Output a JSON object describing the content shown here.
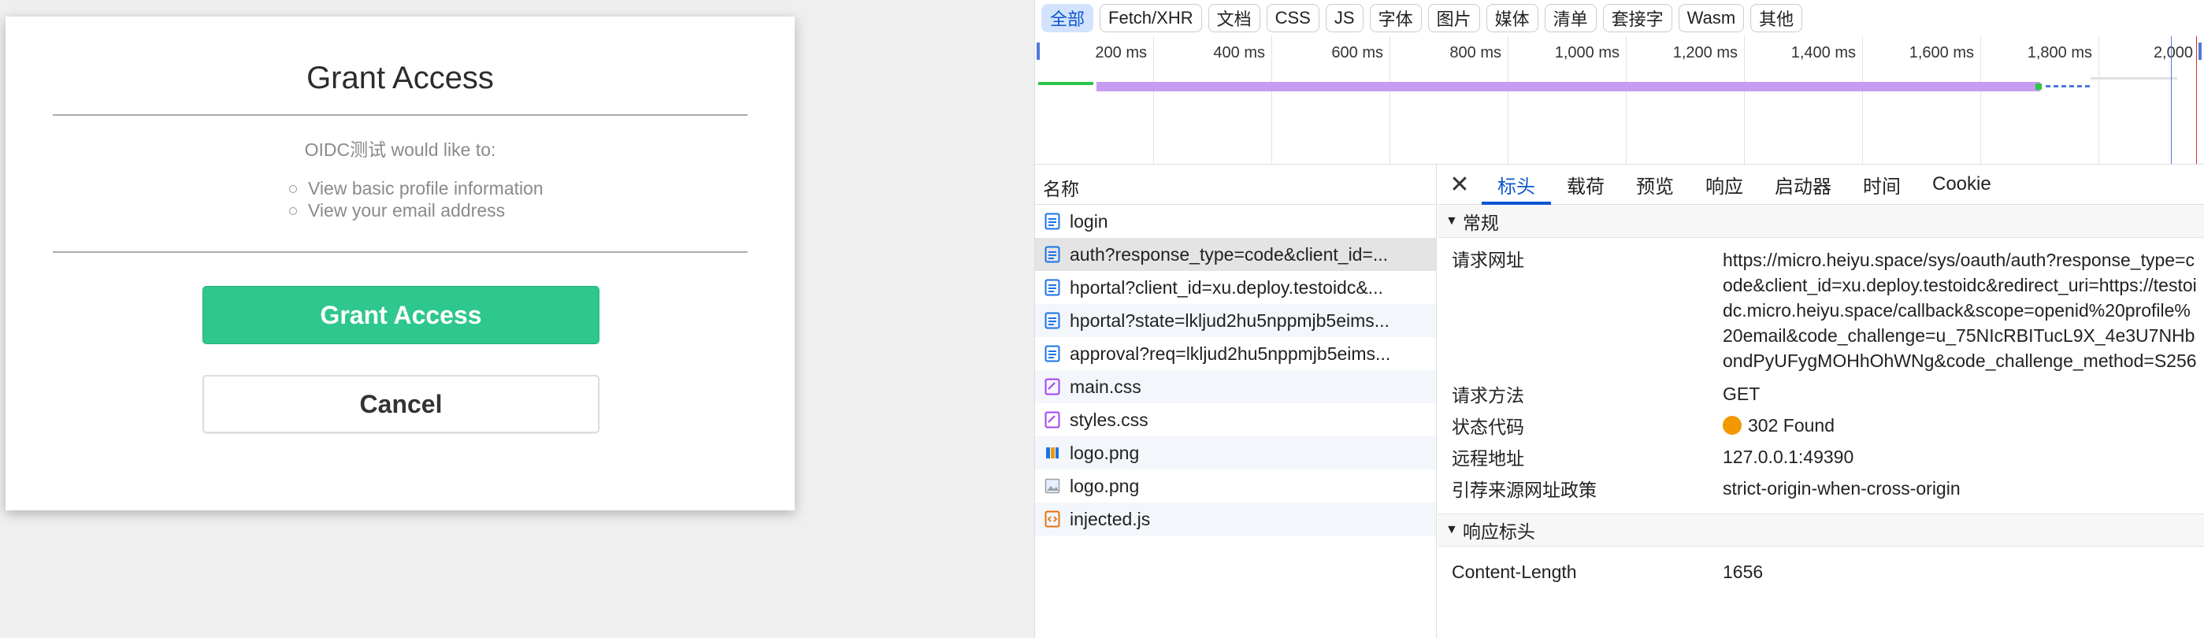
{
  "consent": {
    "title": "Grant Access",
    "prompt": "OIDC测试 would like to:",
    "permissions": [
      "View basic profile information",
      "View your email address"
    ],
    "grant_label": "Grant Access",
    "cancel_label": "Cancel",
    "accent": "#2ec78e"
  },
  "devtools": {
    "filters": [
      "全部",
      "Fetch/XHR",
      "文档",
      "CSS",
      "JS",
      "字体",
      "图片",
      "媒体",
      "清单",
      "套接字",
      "Wasm",
      "其他"
    ],
    "timeline_ticks": [
      "200 ms",
      "400 ms",
      "600 ms",
      "800 ms",
      "1,000 ms",
      "1,200 ms",
      "1,400 ms",
      "1,600 ms",
      "1,800 ms",
      "2,000"
    ],
    "name_header": "名称",
    "requests": [
      {
        "name": "login",
        "icon": "document-icon"
      },
      {
        "name": "auth?response_type=code&client_id=...",
        "icon": "document-icon"
      },
      {
        "name": "hportal?client_id=xu.deploy.testoidc&...",
        "icon": "document-icon"
      },
      {
        "name": "hportal?state=lkljud2hu5nppmjb5eims...",
        "icon": "document-icon"
      },
      {
        "name": "approval?req=lkljud2hu5nppmjb5eims...",
        "icon": "document-icon"
      },
      {
        "name": "main.css",
        "icon": "stylesheet-icon"
      },
      {
        "name": "styles.css",
        "icon": "stylesheet-icon"
      },
      {
        "name": "logo.png",
        "icon": "image-icon"
      },
      {
        "name": "logo.png",
        "icon": "image-icon"
      },
      {
        "name": "injected.js",
        "icon": "script-icon"
      }
    ],
    "tabs": [
      "标头",
      "载荷",
      "预览",
      "响应",
      "启动器",
      "时间",
      "Cookie"
    ],
    "general_section": "常规",
    "general": [
      {
        "key": "请求网址",
        "value": "https://micro.heiyu.space/sys/oauth/auth?response_type=code&client_id=xu.deploy.testoidc&redirect_uri=https://testoidc.micro.heiyu.space/callback&scope=openid%20profile%20email&code_challenge=u_75NIcRBITucL9X_4e3U7NHbondPyUFygMOHhOhWNg&code_challenge_method=S256"
      },
      {
        "key": "请求方法",
        "value": "GET"
      },
      {
        "key": "状态代码",
        "value": "302 Found"
      },
      {
        "key": "远程地址",
        "value": "127.0.0.1:49390"
      },
      {
        "key": "引荐来源网址政策",
        "value": "strict-origin-when-cross-origin"
      }
    ],
    "response_section": "响应标头",
    "response_headers": [
      {
        "key": "Content-Length",
        "value": "1656"
      }
    ]
  }
}
